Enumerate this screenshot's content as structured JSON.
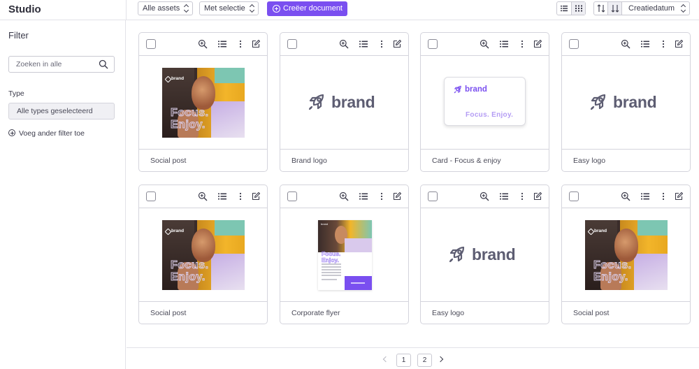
{
  "app": {
    "title": "Studio"
  },
  "toolbar": {
    "assets_select": "Alle assets",
    "selection_select": "Met selectie",
    "create_button": "Creëer document",
    "sort_select": "Creatiedatum",
    "view_mode": "grid"
  },
  "sidebar": {
    "title": "Filter",
    "search_placeholder": "Zoeken in alle",
    "type_label": "Type",
    "type_value": "Alle types geselecteerd",
    "add_filter": "Voeg ander filter toe"
  },
  "cards": [
    {
      "caption": "Social post",
      "preview": "photo"
    },
    {
      "caption": "Brand logo",
      "preview": "brand-logo"
    },
    {
      "caption": "Card - Focus & enjoy",
      "preview": "business-card"
    },
    {
      "caption": "Easy logo",
      "preview": "brand-logo"
    },
    {
      "caption": "Social post",
      "preview": "photo"
    },
    {
      "caption": "Corporate flyer",
      "preview": "flyer"
    },
    {
      "caption": "Easy logo",
      "preview": "brand-logo"
    },
    {
      "caption": "Social post",
      "preview": "photo"
    }
  ],
  "previews": {
    "brand_word": "brand",
    "photo_logo": "brand",
    "photo_text_line1": "Focus.",
    "photo_text_line2": "Enjoy.",
    "card_tagline": "Focus. Enjoy.",
    "flyer_title_line1": "Focus.",
    "flyer_title_line2": "Enjoy."
  },
  "pagination": {
    "pages": [
      "1",
      "2"
    ]
  },
  "colors": {
    "accent": "#7a4ff0",
    "logo_grey": "#5d5d72",
    "border": "#d4d4dc"
  }
}
